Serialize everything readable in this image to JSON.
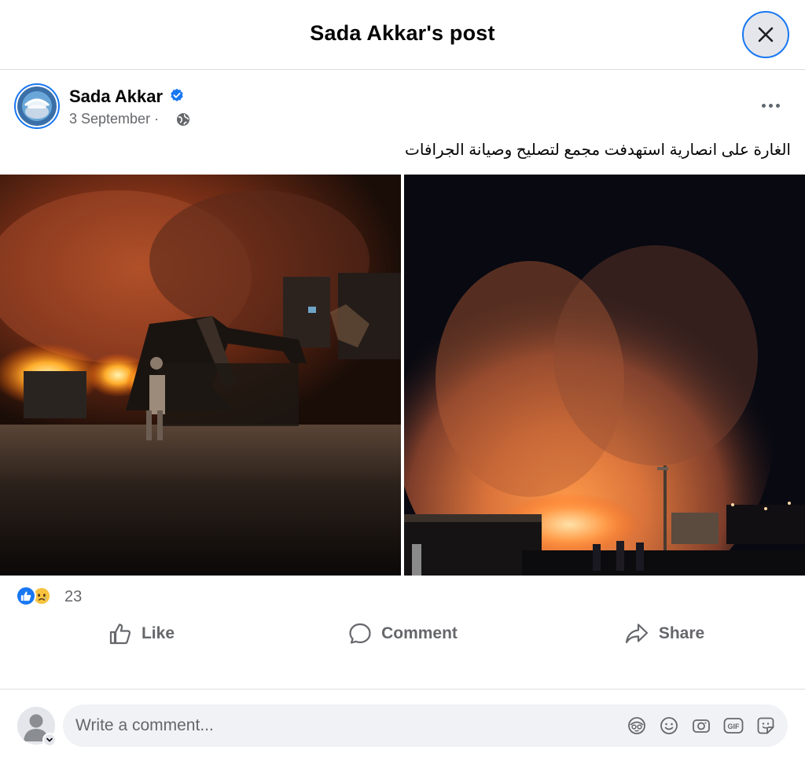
{
  "header": {
    "title": "Sada Akkar's post"
  },
  "post": {
    "author": "Sada Akkar",
    "avatar_text": "Sada Akkar",
    "date": "3 September",
    "date_separator": "·",
    "text": "الغارة على انصارية استهدفت مجمع لتصليح وصيانة الجرافات"
  },
  "reactions": {
    "count": "23"
  },
  "actions": {
    "like": "Like",
    "comment": "Comment",
    "share": "Share"
  },
  "comment_box": {
    "placeholder": "Write a comment..."
  },
  "icons": {
    "close": "close-icon",
    "verified": "verified-badge-icon",
    "globe": "globe-icon",
    "more": "more-options-icon",
    "like": "thumbs-up-icon",
    "comment": "speech-bubble-icon",
    "share": "share-arrow-icon",
    "avatar_sticker": "avatar-sticker-icon",
    "emoji": "emoji-icon",
    "camera": "camera-icon",
    "gif": "gif-icon",
    "sticker": "sticker-icon"
  },
  "colors": {
    "accent": "#1877f2",
    "secondary_text": "#65676b",
    "divider": "#dadde1"
  }
}
